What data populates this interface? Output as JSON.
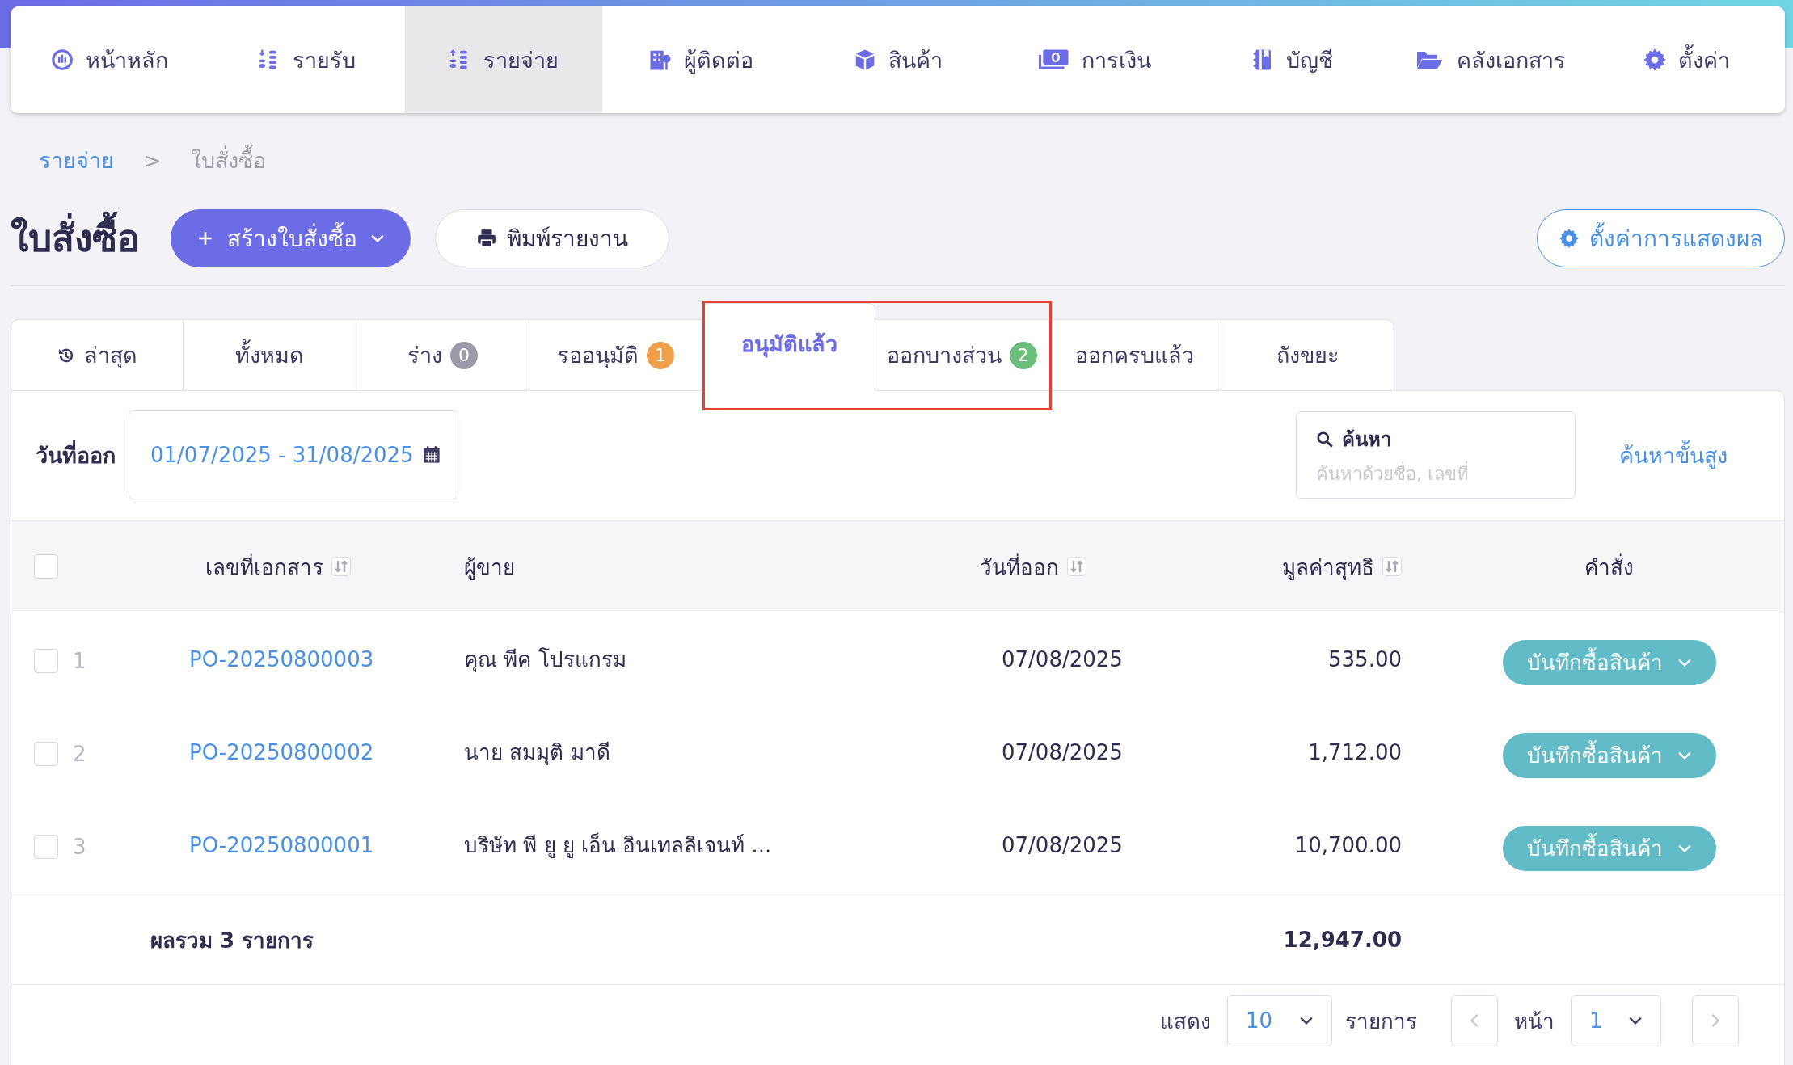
{
  "nav": {
    "items": [
      {
        "label": "หน้าหลัก",
        "selected": false
      },
      {
        "label": "รายรับ",
        "selected": false
      },
      {
        "label": "รายจ่าย",
        "selected": true
      },
      {
        "label": "ผู้ติดต่อ",
        "selected": false
      },
      {
        "label": "สินค้า",
        "selected": false
      },
      {
        "label": "การเงิน",
        "selected": false
      },
      {
        "label": "บัญชี",
        "selected": false
      },
      {
        "label": "คลังเอกสาร",
        "selected": false
      },
      {
        "label": "ตั้งค่า",
        "selected": false
      }
    ]
  },
  "breadcrumb": {
    "items": [
      {
        "label": "รายจ่าย",
        "kind": "link"
      },
      {
        "label": ">",
        "kind": "separator"
      },
      {
        "label": "ใบสั่งซื้อ",
        "kind": "current"
      }
    ]
  },
  "page_title": "ใบสั่งซื้อ",
  "create_button": "สร้างใบสั่งซื้อ",
  "print_button": "พิมพ์รายงาน",
  "display_settings_button": "ตั้งค่าการแสดงผล",
  "tabs": [
    {
      "label": "ล่าสุด",
      "selected": false,
      "highlighted": false
    },
    {
      "label": "ทั้งหมด",
      "selected": false,
      "highlighted": false
    },
    {
      "label": "ร่าง",
      "selected": false,
      "highlighted": false,
      "badge": "0",
      "color": "#9a9aa8"
    },
    {
      "label": "รออนุมัติ",
      "selected": false,
      "highlighted": false,
      "badge": "1",
      "color": "#f0a04b"
    },
    {
      "label": "อนุมัติแล้ว",
      "selected": true,
      "highlighted": true
    },
    {
      "label": "ออกบางส่วน",
      "selected": false,
      "highlighted": true,
      "badge": "2",
      "color": "#6cbf7a"
    },
    {
      "label": "ออกครบแล้ว",
      "selected": false,
      "highlighted": false
    },
    {
      "label": "ถังขยะ",
      "selected": false,
      "highlighted": false
    }
  ],
  "filter": {
    "date_label": "วันที่ออก",
    "date_range": "01/07/2025 - 31/08/2025",
    "search_label": "ค้นหา",
    "search_placeholder": "ค้นหาด้วยชื่อ, เลขที่",
    "advanced_search": "ค้นหาขั้นสูง"
  },
  "table": {
    "select_all": {
      "checked": false
    },
    "columns": [
      {
        "label": "เลขที่เอกสาร",
        "sortable": true
      },
      {
        "label": "ผู้ขาย",
        "sortable": false
      },
      {
        "label": "วันที่ออก",
        "sortable": true
      },
      {
        "label": "มูลค่าสุทธิ",
        "sortable": true
      },
      {
        "label": "คำสั่ง",
        "sortable": false
      }
    ],
    "rows": [
      {
        "number": "1",
        "checked": false,
        "doc_no": "PO-20250800003",
        "seller": "คุณ พีค โปรแกรม",
        "date": "07/08/2025",
        "amount": "535.00",
        "action": "บันทึกซื้อสินค้า"
      },
      {
        "number": "2",
        "checked": false,
        "doc_no": "PO-20250800002",
        "seller": "นาย สมมุติ มาดี",
        "date": "07/08/2025",
        "amount": "1,712.00",
        "action": "บันทึกซื้อสินค้า"
      },
      {
        "number": "3",
        "checked": false,
        "doc_no": "PO-20250800001",
        "seller": "บริษัท พี ยู ยู เอ็น อินเทลลิเจนท์ ...",
        "date": "07/08/2025",
        "amount": "10,700.00",
        "action": "บันทึกซื้อสินค้า"
      }
    ],
    "summary": {
      "label": "ผลรวม 3 รายการ",
      "total": "12,947.00"
    }
  },
  "pagination": {
    "show_label": "แสดง",
    "page_size": "10",
    "unit_label": "รายการ",
    "page_label": "หน้า",
    "page": "1"
  }
}
